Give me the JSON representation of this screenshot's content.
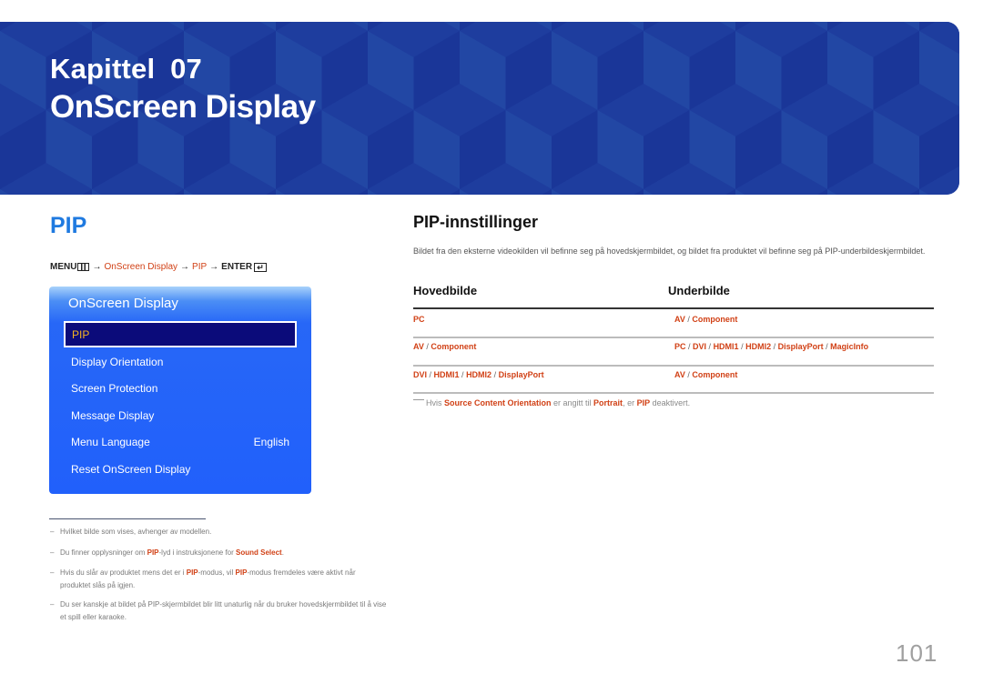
{
  "banner": {
    "chapter_label": "Kapittel  07",
    "title": "OnScreen Display",
    "colors": {
      "base": "#1e3d9e",
      "light": "#2247a4",
      "dark": "#1a3698"
    }
  },
  "left": {
    "heading": "PIP",
    "menu_path": {
      "menu": "MENU",
      "menu_icon": "menu-icon",
      "arrow": "→",
      "step1": "OnScreen Display",
      "step2": "PIP",
      "enter": "ENTER",
      "enter_icon": "enter-icon",
      "enter_glyph": "↵"
    },
    "osd": {
      "title": "OnScreen Display",
      "selected_item": "PIP",
      "items": [
        {
          "label": "Display Orientation",
          "value": ""
        },
        {
          "label": "Screen Protection",
          "value": ""
        },
        {
          "label": "Message Display",
          "value": ""
        },
        {
          "label": "Menu Language",
          "value": "English"
        },
        {
          "label": "Reset OnScreen Display",
          "value": ""
        }
      ]
    },
    "footnotes": [
      {
        "parts": [
          "Hvilket bilde som vises, avhenger av modellen."
        ]
      },
      {
        "parts": [
          "Du finner opplysninger om ",
          "PIP",
          "-lyd i instruksjonene for ",
          "Sound Select",
          "."
        ]
      },
      {
        "parts": [
          "Hvis du slår av produktet mens det er i ",
          "PIP",
          "-modus, vil ",
          "PIP",
          "-modus fremdeles være aktivt når produktet slås på igjen."
        ]
      },
      {
        "parts": [
          "Du ser kanskje at bildet på PIP-skjermbildet blir litt unaturlig når du bruker hovedskjermbildet til å vise et spill eller karaoke."
        ]
      }
    ],
    "footnote_dash": "–"
  },
  "right": {
    "heading": "PIP-innstillinger",
    "intro": "Bildet fra den eksterne videokilden vil befinne seg på hovedskjermbildet, og bildet fra produktet vil befinne seg på PIP-underbildeskjermbildet.",
    "table": {
      "headers": [
        "Hovedbilde",
        "Underbilde"
      ],
      "separator": " / ",
      "rows": [
        {
          "main": [
            "PC"
          ],
          "sub": [
            "AV",
            "Component"
          ]
        },
        {
          "main": [
            "AV",
            "Component"
          ],
          "sub": [
            "PC",
            "DVI",
            "HDMI1",
            "HDMI2",
            "DisplayPort",
            "MagicInfo"
          ]
        },
        {
          "main": [
            "DVI",
            "HDMI1",
            "HDMI2",
            "DisplayPort"
          ],
          "sub": [
            "AV",
            "Component"
          ]
        }
      ]
    },
    "note": {
      "p1": "Hvis ",
      "b1": "Source Content Orientation",
      "p2": " er angitt til ",
      "b2": "Portrait",
      "p3": ", er ",
      "b3": "PIP",
      "p4": " deaktivert."
    }
  },
  "page_number": "101",
  "colors": {
    "accent_blue": "#1f7ae0",
    "link_red": "#d14116",
    "osd_blue": "#2160fb",
    "osd_selected": "#0b0b7a",
    "osd_selected_text": "#f4b321"
  }
}
